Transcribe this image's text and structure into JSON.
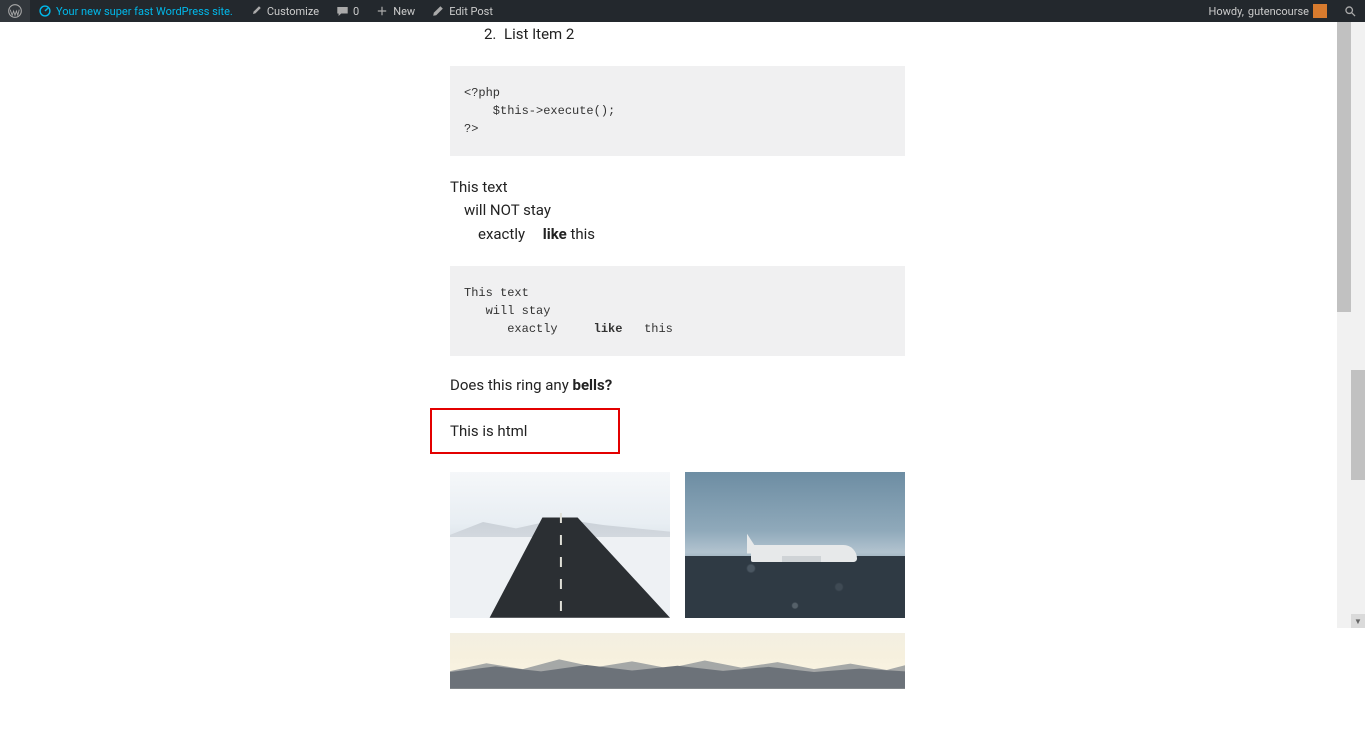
{
  "adminbar": {
    "site_name": "Your new super fast WordPress site.",
    "customize": "Customize",
    "comments_count": "0",
    "new_label": "New",
    "edit_post": "Edit Post",
    "howdy_prefix": "Howdy, ",
    "user_name": "gutencourse"
  },
  "list": {
    "start": 2,
    "items": [
      "List Item 2"
    ]
  },
  "code1": "<?php\n    $this->execute();\n?>",
  "para_nostay": {
    "l1": "This text",
    "l2": "will NOT stay",
    "l3a": "exactly",
    "l3b_bold": "like",
    "l3c": "this"
  },
  "code2": "This text\n   will stay\n      exactly     like   this",
  "ring_sentence": {
    "prefix": "Does this ring any ",
    "bold": "bells?"
  },
  "html_block": "This is html",
  "gallery_alt": [
    "road",
    "plane",
    "mountain-sunset"
  ]
}
